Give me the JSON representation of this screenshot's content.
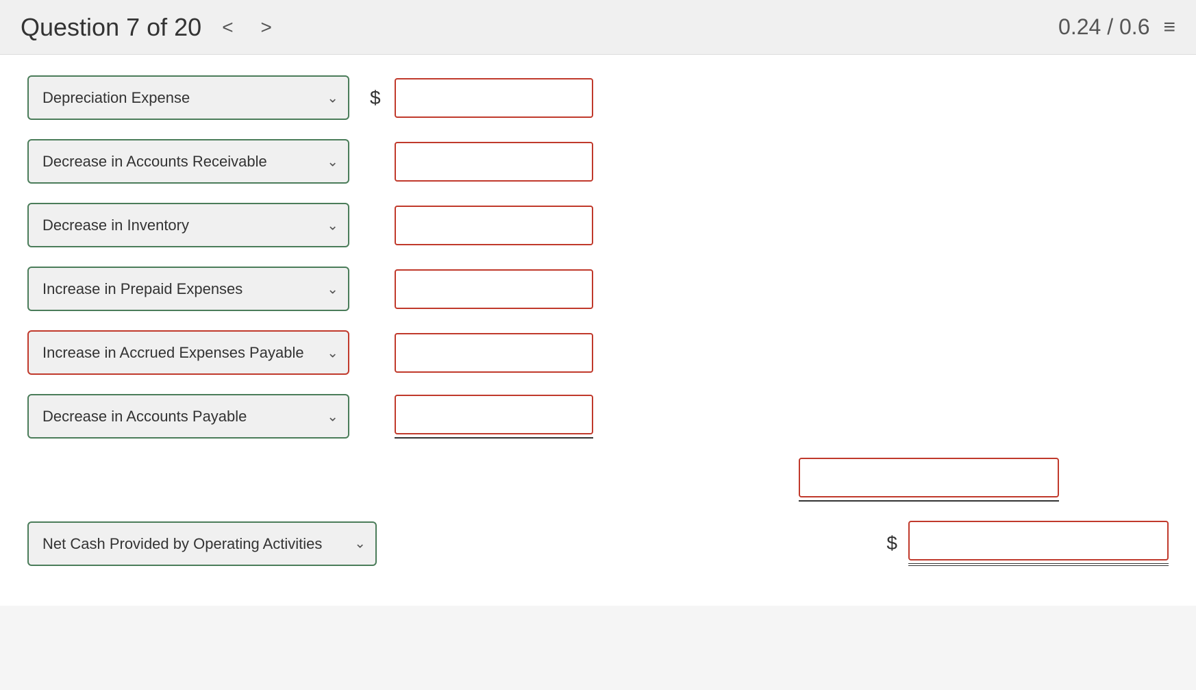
{
  "header": {
    "question_label": "Question 7 of 20",
    "prev_label": "<",
    "next_label": ">",
    "score": "0.24 / 0.6",
    "menu_icon": "≡"
  },
  "rows": [
    {
      "id": "row1",
      "dropdown_value": "Depreciation Expense",
      "dropdown_border": "green",
      "show_dollar": true,
      "input_value": ""
    },
    {
      "id": "row2",
      "dropdown_value": "Decrease in Accounts Receivable",
      "dropdown_border": "green",
      "show_dollar": false,
      "input_value": ""
    },
    {
      "id": "row3",
      "dropdown_value": "Decrease in Inventory",
      "dropdown_border": "green",
      "show_dollar": false,
      "input_value": ""
    },
    {
      "id": "row4",
      "dropdown_value": "Increase in Prepaid Expenses",
      "dropdown_border": "green",
      "show_dollar": false,
      "input_value": ""
    },
    {
      "id": "row5",
      "dropdown_value": "Increase in Accrued Expenses Payable",
      "dropdown_border": "red",
      "show_dollar": false,
      "input_value": ""
    },
    {
      "id": "row6",
      "dropdown_value": "Decrease in Accounts Payable",
      "dropdown_border": "green",
      "show_dollar": false,
      "input_value": ""
    }
  ],
  "subtotal_input_value": "",
  "net_cash": {
    "dropdown_value": "Net Cash Provided by Operating Activities",
    "dropdown_border": "green",
    "dollar_sign": "$",
    "input_value": ""
  },
  "labels": {
    "dollar": "$"
  }
}
